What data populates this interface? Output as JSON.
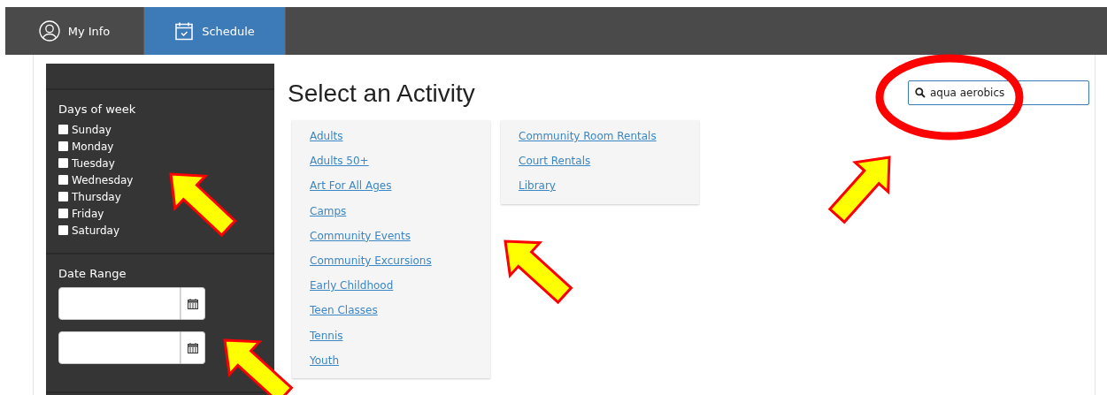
{
  "tabs": [
    {
      "label": "My Info",
      "selected": false
    },
    {
      "label": "Schedule",
      "selected": true
    }
  ],
  "sidebar": {
    "days_heading": "Days of week",
    "days": [
      {
        "label": "Sunday",
        "checked": false
      },
      {
        "label": "Monday",
        "checked": false
      },
      {
        "label": "Tuesday",
        "checked": false
      },
      {
        "label": "Wednesday",
        "checked": false
      },
      {
        "label": "Thursday",
        "checked": false
      },
      {
        "label": "Friday",
        "checked": false
      },
      {
        "label": "Saturday",
        "checked": false
      }
    ],
    "date_range_heading": "Date Range"
  },
  "heading": "Select an Activity",
  "search": {
    "value": "aqua aerobics"
  },
  "category_columns": [
    [
      "Adults",
      "Adults 50+",
      "Art For All Ages",
      "Camps",
      "Community Events",
      "Community Excursions",
      "Early Childhood",
      "Teen Classes",
      "Tennis",
      "Youth"
    ],
    [
      "Community Room Rentals",
      "Court Rentals",
      "Library"
    ]
  ]
}
